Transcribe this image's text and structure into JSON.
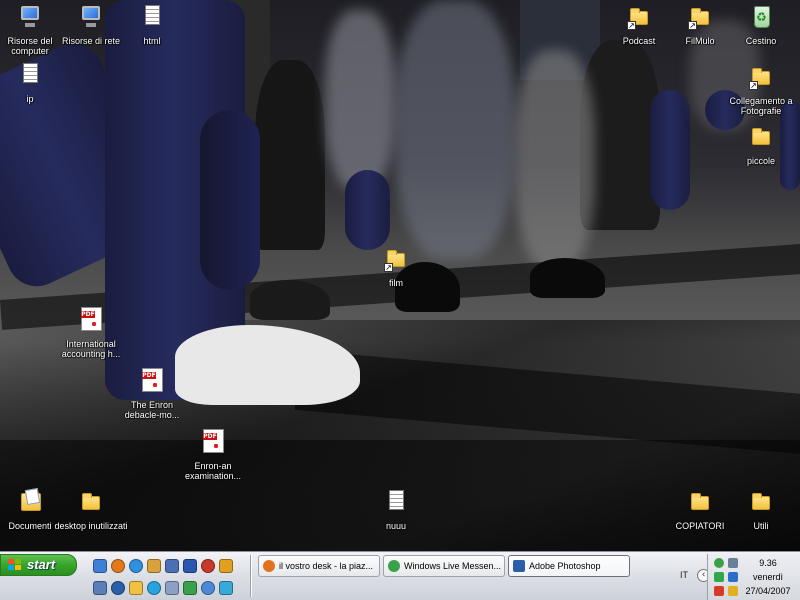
{
  "desktop": {
    "icons": [
      {
        "key": "risorse-computer",
        "label": "Risorse del computer",
        "type": "monitor"
      },
      {
        "key": "risorse-rete",
        "label": "Risorse di rete",
        "type": "monitor"
      },
      {
        "key": "html",
        "label": "html",
        "type": "doc"
      },
      {
        "key": "ip",
        "label": "ip",
        "type": "doc"
      },
      {
        "key": "podcast",
        "label": "Podcast",
        "type": "folder-shortcut"
      },
      {
        "key": "filmulo",
        "label": "FilMulo",
        "type": "folder-shortcut"
      },
      {
        "key": "cestino",
        "label": "Cestino",
        "type": "recycle"
      },
      {
        "key": "collegamento-fotografie",
        "label": "Collegamento a Fotografie",
        "type": "folder-shortcut"
      },
      {
        "key": "piccole",
        "label": "piccole",
        "type": "folder"
      },
      {
        "key": "film",
        "label": "film",
        "type": "folder-shortcut"
      },
      {
        "key": "international-accounting",
        "label": "International accounting h...",
        "type": "pdf"
      },
      {
        "key": "enron-debacle",
        "label": "The Enron debacle-mo...",
        "type": "pdf"
      },
      {
        "key": "enron-examination",
        "label": "Enron-an examination...",
        "type": "pdf"
      },
      {
        "key": "documenti",
        "label": "Documenti",
        "type": "mydocs"
      },
      {
        "key": "desktop-inutilizzati",
        "label": "desktop inutilizzati",
        "type": "folder"
      },
      {
        "key": "nuuu",
        "label": "nuuu",
        "type": "doc"
      },
      {
        "key": "copiatori",
        "label": "COPIATORI",
        "type": "folder"
      },
      {
        "key": "utili",
        "label": "Utili",
        "type": "folder"
      }
    ]
  },
  "taskbar": {
    "start_label": "start",
    "tasks": [
      {
        "label": "il vostro desk - la piaz...",
        "icon_color": "#e2731c"
      },
      {
        "label": "Windows Live Messen...",
        "icon_color": "#3aa04a"
      },
      {
        "label": "Adobe Photoshop",
        "icon_color": "#2b5fa8"
      }
    ],
    "language": "IT",
    "clock": {
      "time": "9.36",
      "day": "venerdì",
      "date": "27/04/2007"
    }
  }
}
